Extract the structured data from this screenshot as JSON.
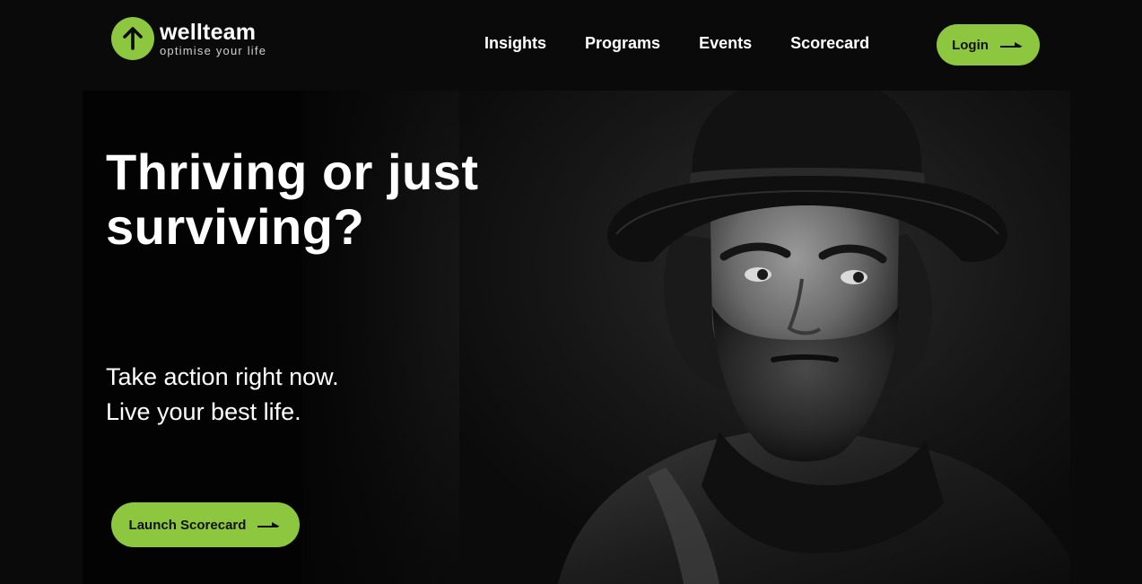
{
  "brand": {
    "name": "wellteam",
    "tagline": "optimise your life",
    "logo_icon": "arrow-up-icon",
    "accent_color": "#8dc63f"
  },
  "nav": {
    "items": [
      {
        "label": "Insights"
      },
      {
        "label": "Programs"
      },
      {
        "label": "Events"
      },
      {
        "label": "Scorecard"
      }
    ],
    "login_label": "Login"
  },
  "hero": {
    "title": "Thriving or just surviving?",
    "subtitle_line1": "Take action right now.",
    "subtitle_line2": "Live your best life.",
    "cta_label": "Launch Scorecard",
    "image": "portrait-photo"
  }
}
